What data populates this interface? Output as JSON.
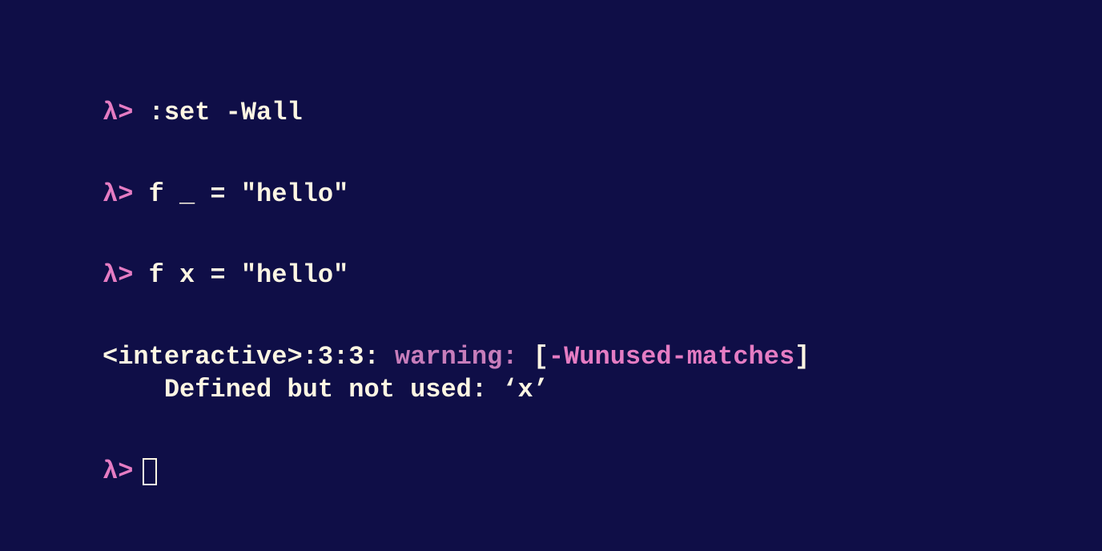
{
  "terminal": {
    "prompt_symbol": "λ>",
    "entries": [
      {
        "command": ":set -Wall"
      },
      {
        "command": "f _ = \"hello\""
      },
      {
        "command": "f x = \"hello\""
      }
    ],
    "warning": {
      "location": "<interactive>:3:3:",
      "label": "warning:",
      "bracket_open": "[",
      "flag": "-Wunused-matches",
      "bracket_close": "]",
      "message_indent": "    ",
      "message": "Defined but not used: ‘x’"
    }
  }
}
